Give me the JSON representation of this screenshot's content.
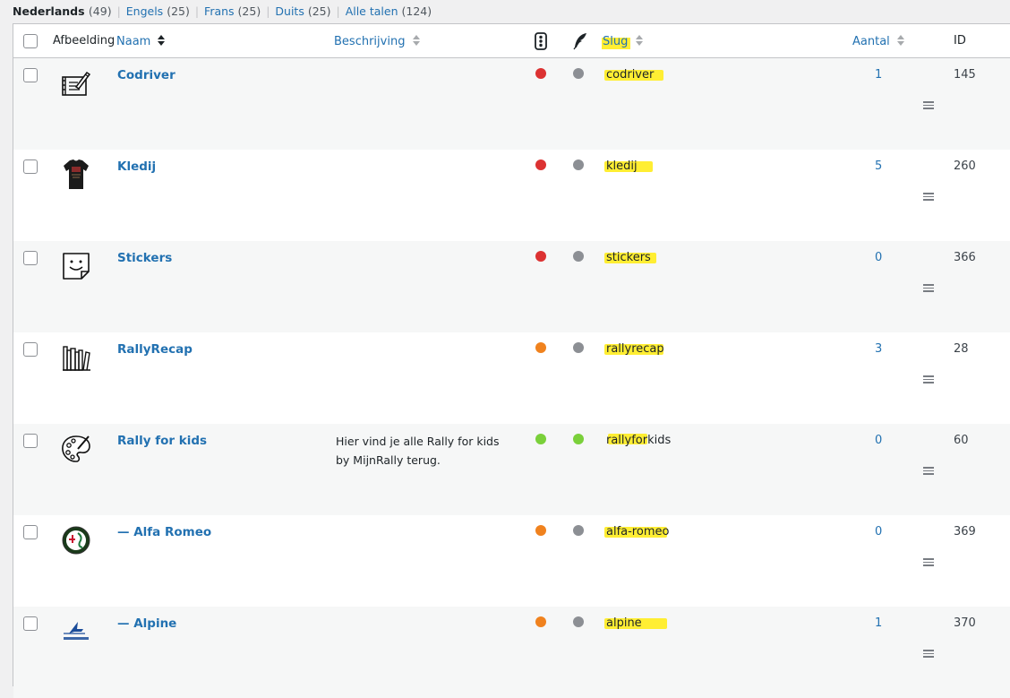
{
  "languages": [
    {
      "label": "Nederlands",
      "count": "(49)",
      "current": true
    },
    {
      "label": "Engels",
      "count": "(25)",
      "current": false
    },
    {
      "label": "Frans",
      "count": "(25)",
      "current": false
    },
    {
      "label": "Duits",
      "count": "(25)",
      "current": false
    },
    {
      "label": "Alle talen",
      "count": "(124)",
      "current": false
    }
  ],
  "columns": {
    "image": "Afbeelding",
    "name": "Naam",
    "description": "Beschrijving",
    "slug": "Slug",
    "count": "Aantal",
    "id": "ID"
  },
  "colors": {
    "link": "#2271b1",
    "status_red": "#dc3232",
    "status_orange": "#f0821e",
    "status_green": "#7ad03a",
    "status_grey": "#8c8f94",
    "highlight": "#ffee33"
  },
  "rows": [
    {
      "name": "Codriver",
      "description": "",
      "status": "red",
      "seo": "grey",
      "slug": "codriver",
      "count": "1",
      "id": "145",
      "icon": "notebook-pen-icon"
    },
    {
      "name": "Kledij",
      "description": "",
      "status": "red",
      "seo": "grey",
      "slug": "kledij",
      "count": "5",
      "id": "260",
      "icon": "tshirt-icon"
    },
    {
      "name": "Stickers",
      "description": "",
      "status": "red",
      "seo": "grey",
      "slug": "stickers",
      "count": "0",
      "id": "366",
      "icon": "sticker-icon"
    },
    {
      "name": "RallyRecap",
      "description": "",
      "status": "orange",
      "seo": "grey",
      "slug": "rallyrecap",
      "count": "3",
      "id": "28",
      "icon": "books-icon"
    },
    {
      "name": "Rally for kids",
      "description": "Hier vind je alle Rally for kids by MijnRally terug.",
      "status": "green",
      "seo": "green",
      "slug": "rallyforkids",
      "count": "0",
      "id": "60",
      "icon": "palette-icon"
    },
    {
      "name": "— Alfa Romeo",
      "description": "",
      "status": "orange",
      "seo": "grey",
      "slug": "alfa-romeo",
      "count": "0",
      "id": "369",
      "icon": "alfa-romeo-logo-icon"
    },
    {
      "name": "— Alpine",
      "description": "",
      "status": "orange",
      "seo": "grey",
      "slug": "alpine",
      "count": "1",
      "id": "370",
      "icon": "alpine-logo-icon"
    }
  ]
}
